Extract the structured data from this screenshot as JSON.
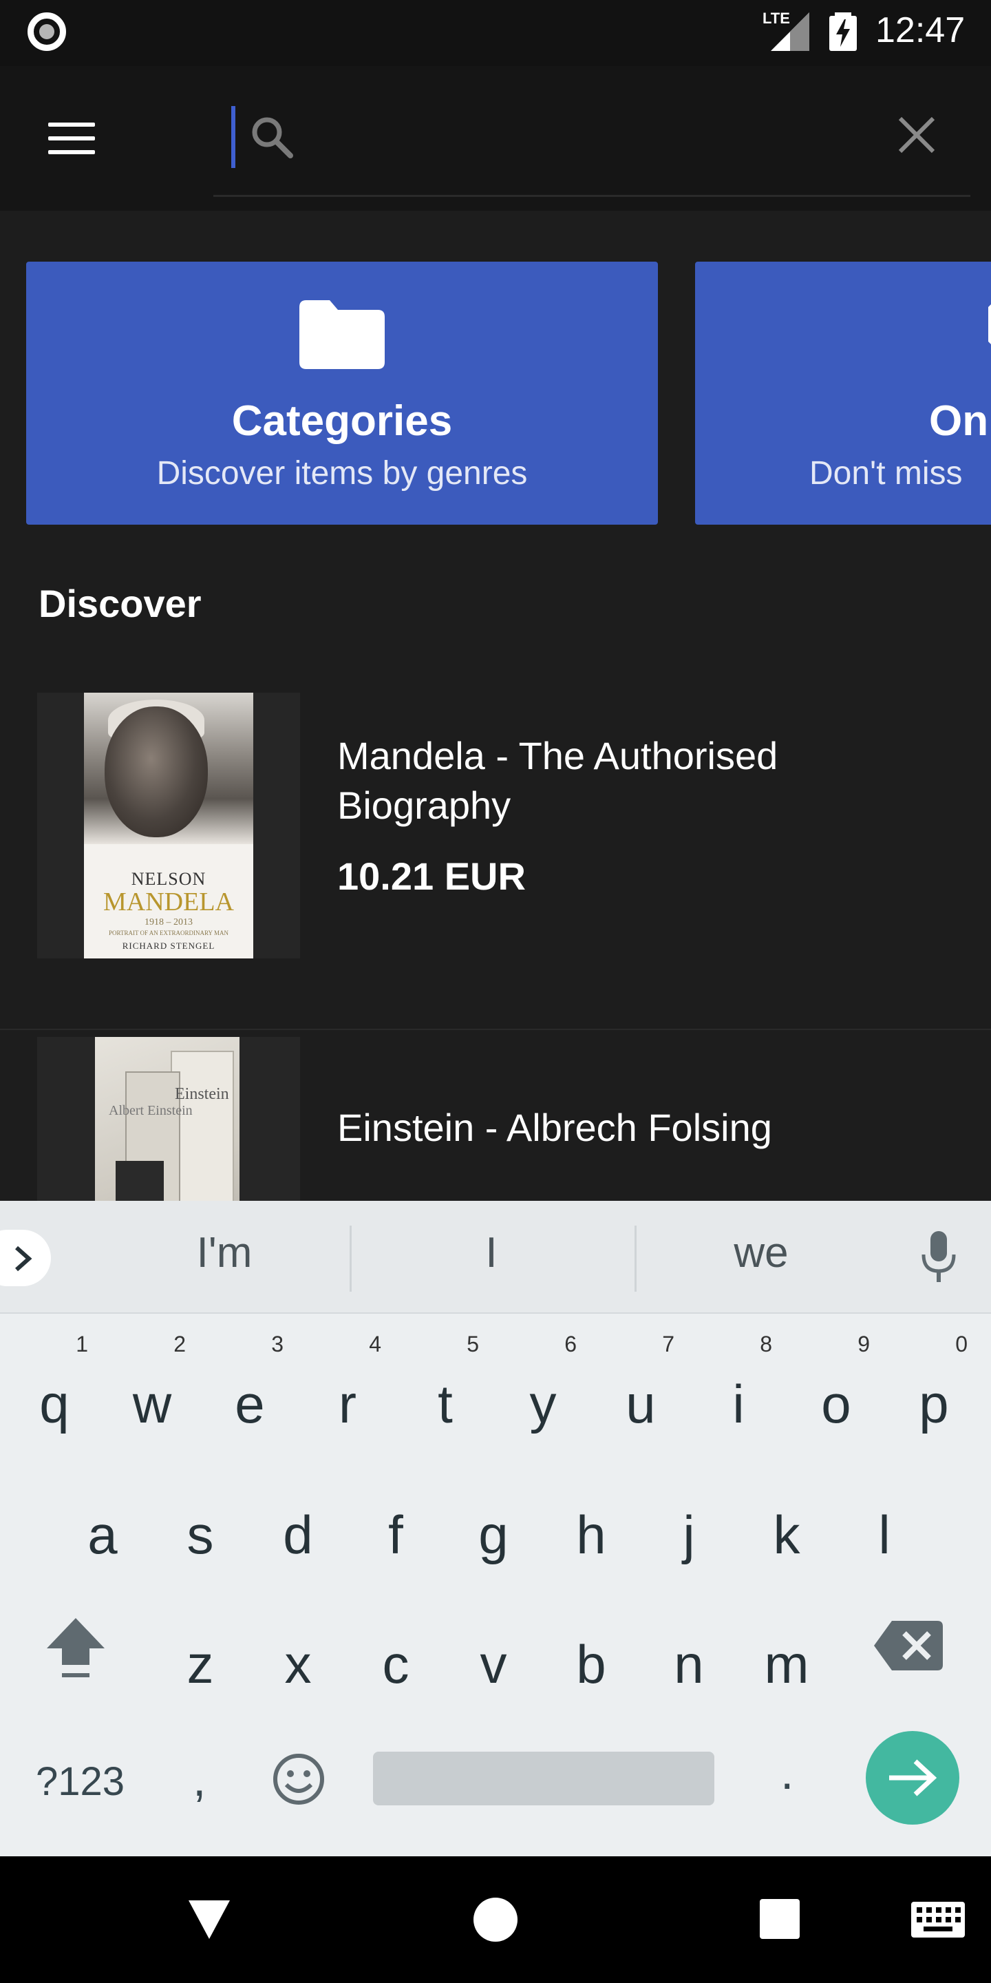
{
  "status_bar": {
    "network": "LTE",
    "time": "12:47"
  },
  "search": {
    "value": "",
    "placeholder": ""
  },
  "promo_cards": [
    {
      "title": "Categories",
      "subtitle": "Discover items by genres",
      "icon": "folder-icon"
    },
    {
      "title": "On",
      "subtitle": "Don't miss",
      "icon": "tag-icon"
    }
  ],
  "discover": {
    "title": "Discover",
    "items": [
      {
        "title": "Mandela - The Authorised Biography",
        "price": "10.21 EUR",
        "cover": {
          "line1": "NELSON",
          "line2": "MANDELA",
          "line3": "1918 – 2013",
          "line4": "PORTRAIT OF AN EXTRAORDINARY MAN",
          "line5": "RICHARD STENGEL"
        }
      },
      {
        "title": "Einstein - Albrech Folsing",
        "price": "",
        "cover": {
          "line1": "Albert Einstein",
          "line2": "Einstein"
        }
      }
    ]
  },
  "keyboard": {
    "suggestions": [
      "I'm",
      "I",
      "we"
    ],
    "row1": [
      {
        "key": "q",
        "hint": "1"
      },
      {
        "key": "w",
        "hint": "2"
      },
      {
        "key": "e",
        "hint": "3"
      },
      {
        "key": "r",
        "hint": "4"
      },
      {
        "key": "t",
        "hint": "5"
      },
      {
        "key": "y",
        "hint": "6"
      },
      {
        "key": "u",
        "hint": "7"
      },
      {
        "key": "i",
        "hint": "8"
      },
      {
        "key": "o",
        "hint": "9"
      },
      {
        "key": "p",
        "hint": "0"
      }
    ],
    "row2": [
      "a",
      "s",
      "d",
      "f",
      "g",
      "h",
      "j",
      "k",
      "l"
    ],
    "row3": [
      "z",
      "x",
      "c",
      "v",
      "b",
      "n",
      "m"
    ],
    "symbols_label": "?123",
    "comma_label": ",",
    "period_label": "."
  },
  "colors": {
    "accent": "#3c5bbd",
    "enter": "#43b8a0",
    "background": "#1d1d1d"
  }
}
